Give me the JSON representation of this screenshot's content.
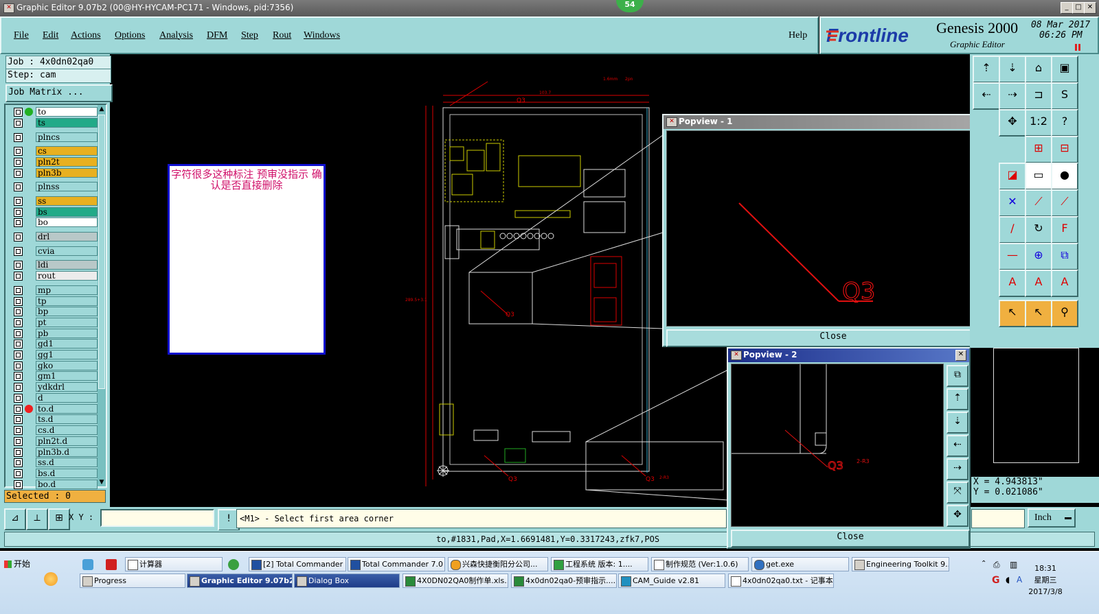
{
  "window": {
    "title": "Graphic Editor 9.07b2 (00@HY-HYCAM-PC171 - Windows, pid:7356)",
    "counter_badge": "54"
  },
  "menu": [
    "File",
    "Edit",
    "Actions",
    "Options",
    "Analysis",
    "DFM",
    "Step",
    "Rout",
    "Windows"
  ],
  "help": "Help",
  "brand": {
    "logo": "Frontline",
    "product": "Genesis 2000",
    "subtitle": "Graphic Editor",
    "date": "08 Mar 2017",
    "time": "06:26 PM"
  },
  "job": {
    "job_label": "Job  : 4x0dn02qa0",
    "step_label": "Step: cam",
    "matrix_button": "Job Matrix ..."
  },
  "layers": [
    {
      "name": "to",
      "color": "#ffffff",
      "dot": "#22b022"
    },
    {
      "name": "ts",
      "color": "#22aa88"
    },
    {
      "name": "plncs",
      "color": "#9fd8d8"
    },
    {
      "name": "cs",
      "color": "#e8b020"
    },
    {
      "name": "pln2t",
      "color": "#e8b020"
    },
    {
      "name": "pln3b",
      "color": "#e8b020"
    },
    {
      "name": "plnss",
      "color": "#9fd8d8"
    },
    {
      "name": "ss",
      "color": "#e8b020"
    },
    {
      "name": "bs",
      "color": "#22aa88"
    },
    {
      "name": "bo",
      "color": "#ffffff"
    },
    {
      "name": "drl",
      "color": "#b8c8c8"
    },
    {
      "name": "cvia",
      "color": "#9fd8d8"
    },
    {
      "name": "ldi",
      "color": "#b8c8c8"
    },
    {
      "name": "rout",
      "color": "#ececec"
    },
    {
      "name": "mp",
      "color": "#9fd8d8"
    },
    {
      "name": "tp",
      "color": "#9fd8d8"
    },
    {
      "name": "bp",
      "color": "#9fd8d8"
    },
    {
      "name": "pt",
      "color": "#9fd8d8"
    },
    {
      "name": "pb",
      "color": "#9fd8d8"
    },
    {
      "name": "gd1",
      "color": "#9fd8d8"
    },
    {
      "name": "gg1",
      "color": "#9fd8d8"
    },
    {
      "name": "gko",
      "color": "#9fd8d8"
    },
    {
      "name": "gm1",
      "color": "#9fd8d8"
    },
    {
      "name": "ydkdrl",
      "color": "#9fd8d8"
    },
    {
      "name": "d",
      "color": "#9fd8d8"
    },
    {
      "name": "to.d",
      "color": "#9fd8d8",
      "dot": "#ee2020"
    },
    {
      "name": "ts.d",
      "color": "#9fd8d8"
    },
    {
      "name": "cs.d",
      "color": "#9fd8d8"
    },
    {
      "name": "pln2t.d",
      "color": "#9fd8d8"
    },
    {
      "name": "pln3b.d",
      "color": "#9fd8d8"
    },
    {
      "name": "ss.d",
      "color": "#9fd8d8"
    },
    {
      "name": "bs.d",
      "color": "#9fd8d8"
    },
    {
      "name": "bo.d",
      "color": "#9fd8d8"
    }
  ],
  "selected": "Selected : 0",
  "note": {
    "text": "字符很多这种标注  预审没指示  确认是否直接删除"
  },
  "canvas_labels": {
    "q3_label": "Q3",
    "dim_w": "103.7",
    "dim_h": "289.5+3.1",
    "r2_label": "2-R3",
    "pin": "2pn",
    "small": "1.6mm"
  },
  "popview1": {
    "title": "Popview - 1",
    "label": "Q3",
    "close": "Close"
  },
  "popview2": {
    "title": "Popview - 2",
    "label": "Q3",
    "label2": "2-R3",
    "close": "Close"
  },
  "coords": {
    "x": "X = 4.943813\"",
    "y": "Y = 0.021086\""
  },
  "units": "Inch",
  "command": {
    "xy_label": "X Y :",
    "xy_value": "",
    "prompt": "<M1> - Select first area corner"
  },
  "status": "to,#1831,Pad,X=1.6691481,Y=0.3317243,zfk7,POS",
  "taskbar": {
    "start": "开始",
    "row1": [
      "计算器",
      "[2] Total Commander ...",
      "Total Commander 7.0 ...",
      "兴森快捷衡阳分公司...",
      "工程系统  版本: 1....",
      "制作规范 (Ver:1.0.6)",
      "get.exe",
      "Engineering Toolkit 9...."
    ],
    "row2": [
      "Progress",
      "Graphic Editor 9.07b2 ...",
      "Dialog Box",
      "4X0DN02QA0制作单.xls...",
      "4x0dn02qa0-预审指示....",
      "CAM_Guide v2.81",
      "4x0dn02qa0.txt - 记事本"
    ],
    "clock_time": "18:31",
    "clock_day": "星期三",
    "clock_date": "2017/3/8"
  }
}
